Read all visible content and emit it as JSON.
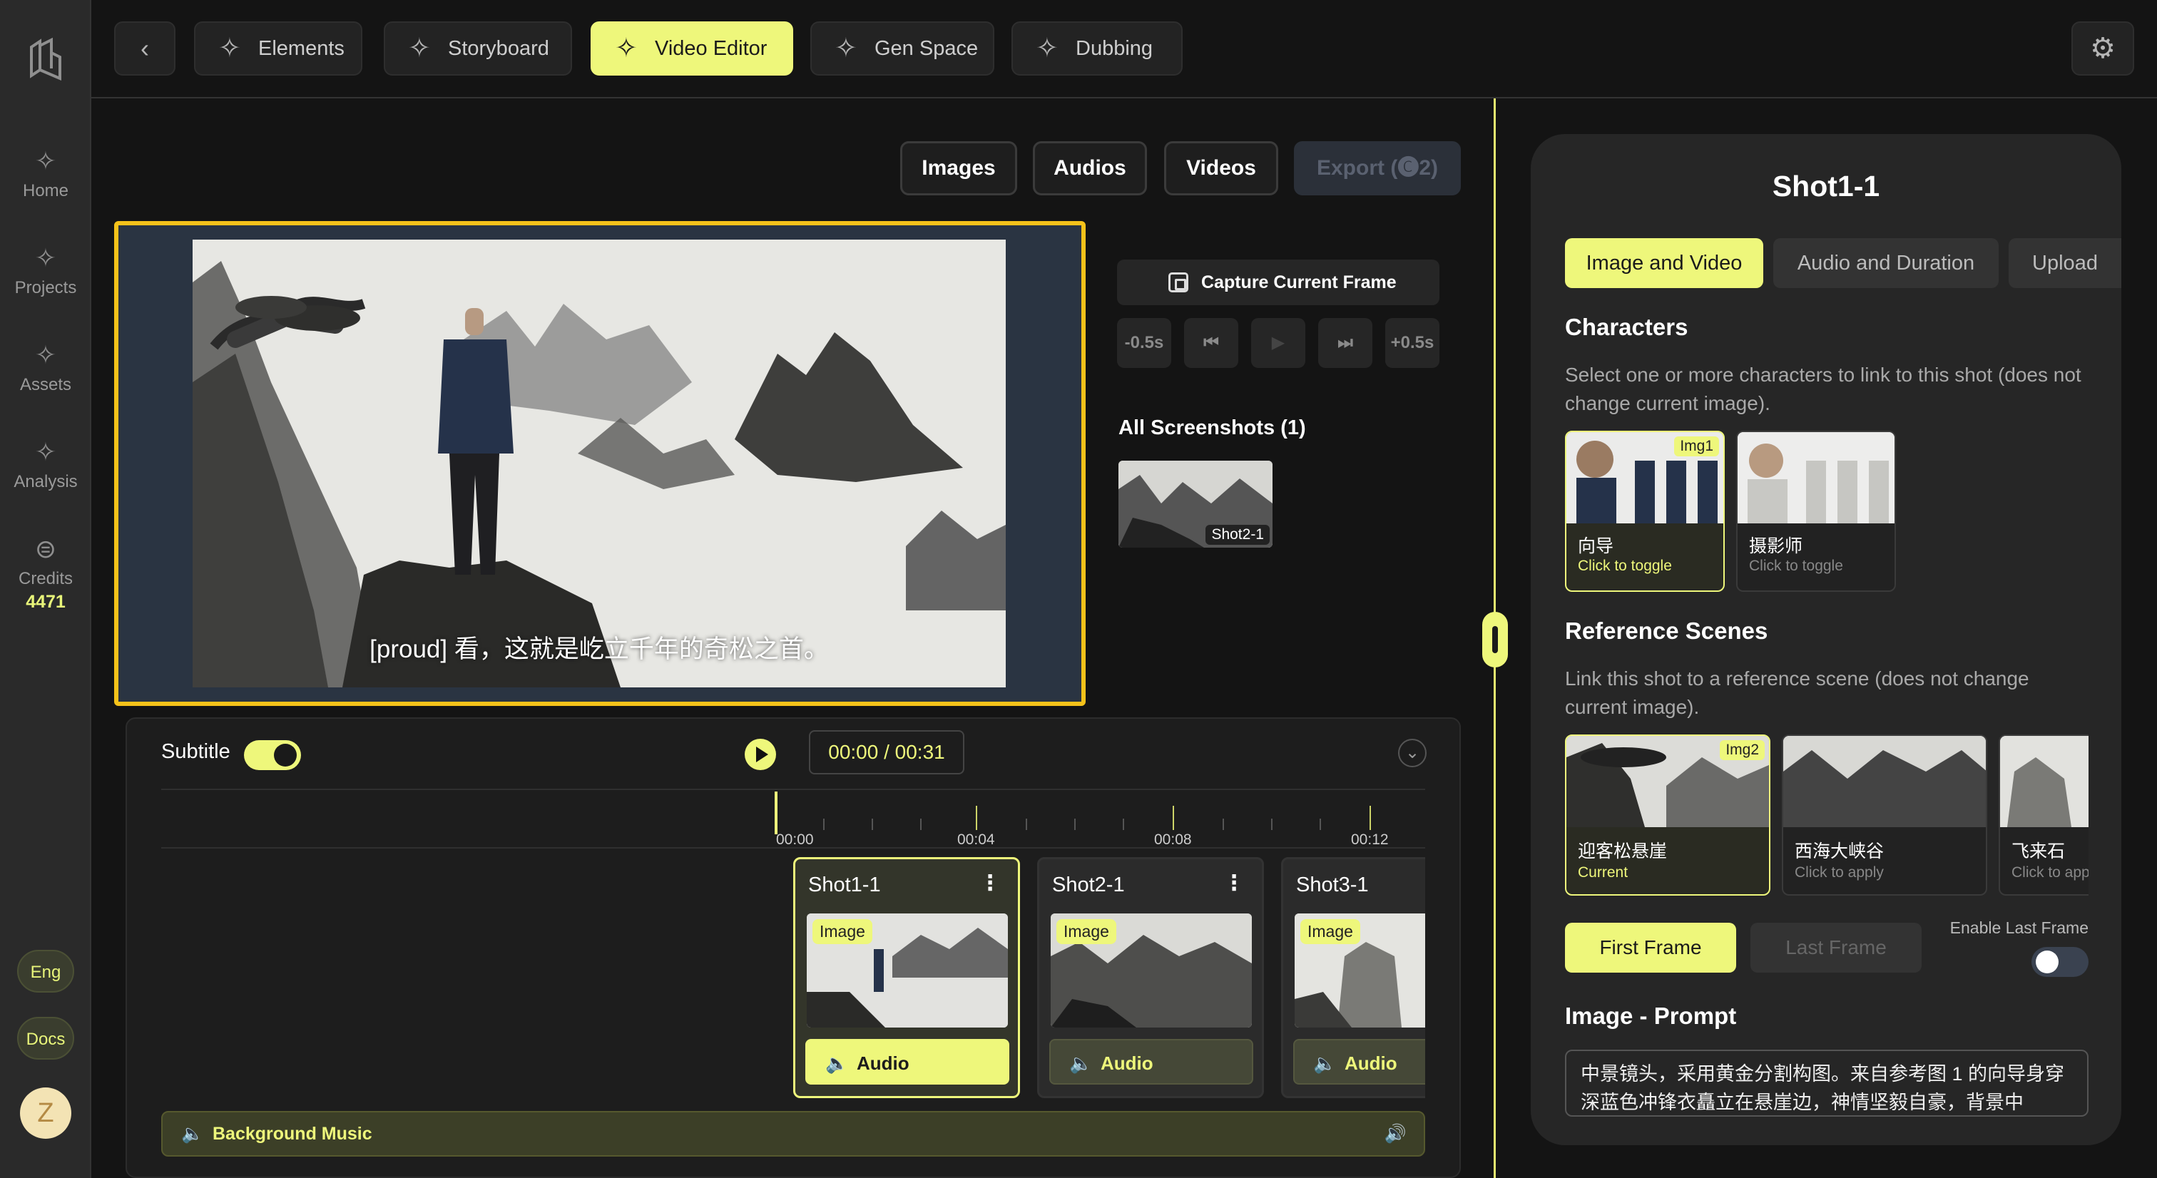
{
  "sidebar": {
    "items": [
      {
        "label": "Home",
        "icon": "sparkle-icon"
      },
      {
        "label": "Projects",
        "icon": "sparkle-icon"
      },
      {
        "label": "Assets",
        "icon": "sparkle-icon"
      },
      {
        "label": "Analysis",
        "icon": "sparkle-icon"
      },
      {
        "label": "Credits",
        "icon": "dollar-icon"
      }
    ],
    "credits_value": "4471",
    "language": "Eng",
    "docs": "Docs",
    "avatar_initial": "Z"
  },
  "top_tabs": [
    {
      "label": "Elements"
    },
    {
      "label": "Storyboard"
    },
    {
      "label": "Video Editor",
      "active": true
    },
    {
      "label": "Gen Space"
    },
    {
      "label": "Dubbing"
    }
  ],
  "media_buttons": {
    "images": "Images",
    "audios": "Audios",
    "videos": "Videos",
    "export": "Export (🅒2)"
  },
  "preview": {
    "subtitle": "[proud] 看，这就是屹立千年的奇松之首。"
  },
  "capture": {
    "button_label": "Capture Current Frame",
    "minus": "-0.5s",
    "plus": "+0.5s",
    "screenshots_title": "All Screenshots (1)",
    "screenshot_tag": "Shot2-1"
  },
  "timeline": {
    "subtitle_label": "Subtitle",
    "subtitle_on": true,
    "time": "00:00 / 00:31",
    "ruler_labels": [
      "00:00",
      "00:04",
      "00:08",
      "00:12"
    ],
    "shots": [
      {
        "name": "Shot1-1",
        "tag": "Image",
        "audio": "Audio",
        "selected": true
      },
      {
        "name": "Shot2-1",
        "tag": "Image",
        "audio": "Audio"
      },
      {
        "name": "Shot3-1",
        "tag": "Image",
        "audio": "Audio"
      }
    ],
    "background_music": "Background Music"
  },
  "right_panel": {
    "title": "Shot1-1",
    "tabs": [
      "Image and Video",
      "Audio and Duration",
      "Upload"
    ],
    "characters": {
      "title": "Characters",
      "desc": "Select one or more characters to link to this shot (does not change current image).",
      "items": [
        {
          "name": "向导",
          "sub": "Click to toggle",
          "tag": "Img1",
          "selected": true
        },
        {
          "name": "摄影师",
          "sub": "Click to toggle"
        }
      ]
    },
    "scenes": {
      "title": "Reference Scenes",
      "desc": "Link this shot to a reference scene (does not change current image).",
      "items": [
        {
          "name": "迎客松悬崖",
          "sub": "Current",
          "tag": "Img2",
          "selected": true
        },
        {
          "name": "西海大峡谷",
          "sub": "Click to apply"
        },
        {
          "name": "飞来石",
          "sub": "Click to apply"
        }
      ]
    },
    "first_frame": "First Frame",
    "last_frame": "Last Frame",
    "enable_last_frame": "Enable Last Frame",
    "enable_last_frame_on": false,
    "prompt_title": "Image - Prompt",
    "prompt_text": "中景镜头，采用黄金分割构图。来自参考图 1 的向导身穿深蓝色冲锋衣矗立在悬崖边，神情坚毅自豪，背景中"
  },
  "colors": {
    "accent": "#eef77b",
    "selection": "#f5c21a",
    "background": "#141414"
  }
}
